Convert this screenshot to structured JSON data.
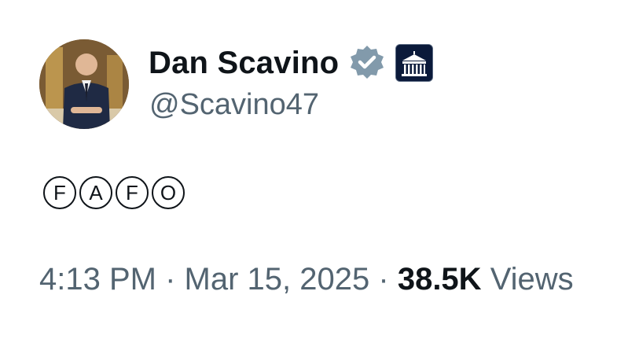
{
  "author": {
    "display_name": "Dan Scavino",
    "handle": "@Scavino47",
    "verified_icon": "verified-badge-icon",
    "affiliation_icon": "white-house-badge-icon"
  },
  "post": {
    "letters": [
      "F",
      "A",
      "F",
      "O"
    ]
  },
  "meta": {
    "time": "4:13 PM",
    "separator": "·",
    "date": "Mar 15, 2025",
    "views_count": "38.5K",
    "views_label": "Views"
  },
  "colors": {
    "text_primary": "#0f1419",
    "text_secondary": "#536471",
    "verified_gray": "#829aab"
  }
}
